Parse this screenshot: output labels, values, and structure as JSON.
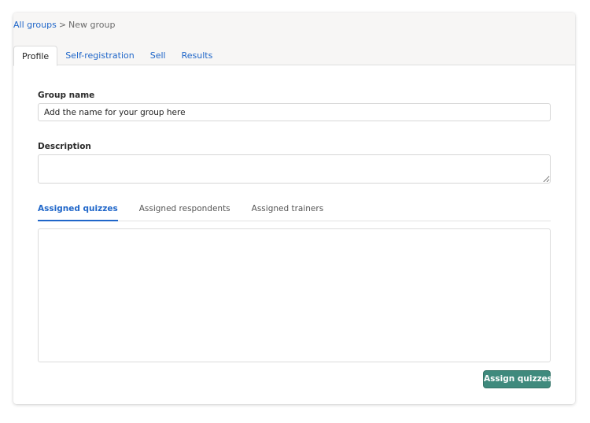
{
  "breadcrumb": {
    "parent": "All groups",
    "separator": ">",
    "current": "New group"
  },
  "top_tabs": [
    {
      "label": "Profile",
      "active": true
    },
    {
      "label": "Self-registration",
      "active": false
    },
    {
      "label": "Sell",
      "active": false
    },
    {
      "label": "Results",
      "active": false
    }
  ],
  "form": {
    "group_name_label": "Group name",
    "group_name_placeholder": "Add the name for your group here",
    "description_label": "Description",
    "description_value": ""
  },
  "sub_tabs": [
    {
      "label": "Assigned quizzes",
      "active": true
    },
    {
      "label": "Assigned respondents",
      "active": false
    },
    {
      "label": "Assigned trainers",
      "active": false
    }
  ],
  "actions": {
    "assign_label": "Assign quizzes"
  },
  "colors": {
    "link": "#1f66c9",
    "header_bg": "#f7f6f5",
    "button": "#3f8a7d"
  }
}
